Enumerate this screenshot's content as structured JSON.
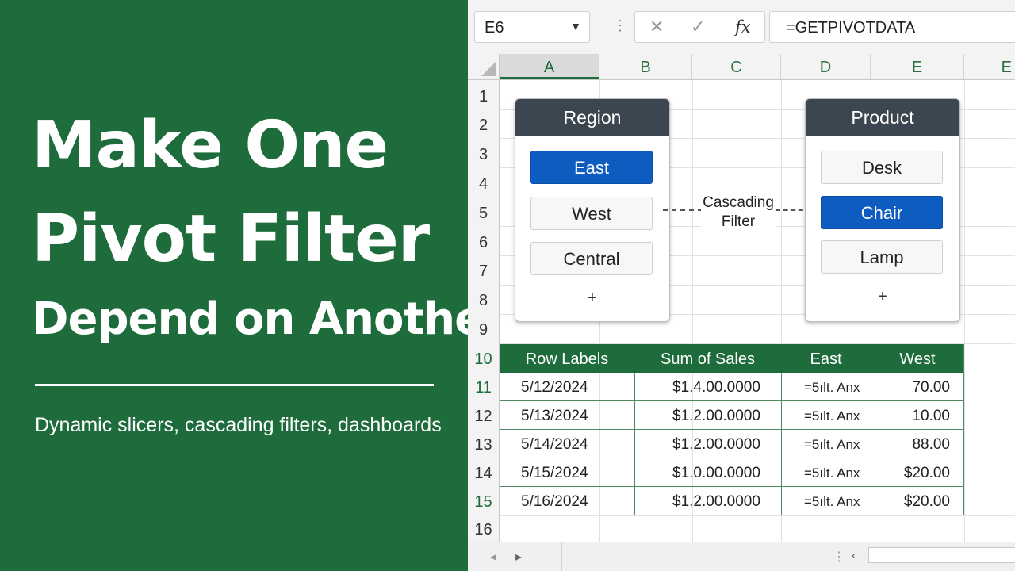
{
  "hero": {
    "line1": "Make One",
    "line2": "Pivot Filter",
    "line3": "Depend on Another",
    "subtitle": "Dynamic slicers, cascading filters, dashboards"
  },
  "formula_bar": {
    "name_box": "E6",
    "cancel_icon": "✕",
    "enter_icon": "✓",
    "fx_label": "fx",
    "formula": "=GETPIVOTDATA"
  },
  "columns": [
    "A",
    "B",
    "C",
    "D",
    "E",
    "E"
  ],
  "rows": [
    "1",
    "2",
    "3",
    "4",
    "5",
    "6",
    "7",
    "8",
    "9",
    "10",
    "11",
    "12",
    "13",
    "14",
    "15",
    "16"
  ],
  "region_slicer": {
    "title": "Region",
    "items": [
      {
        "label": "East",
        "selected": true
      },
      {
        "label": "West",
        "selected": false
      },
      {
        "label": "Central",
        "selected": false
      }
    ],
    "add": "+"
  },
  "product_slicer": {
    "title": "Product",
    "items": [
      {
        "label": "Desk",
        "selected": false
      },
      {
        "label": "Chair",
        "selected": true
      },
      {
        "label": "Lamp",
        "selected": false
      }
    ],
    "add": "+"
  },
  "connector_label": {
    "line1": "Cascading",
    "line2": "Filter"
  },
  "pivot": {
    "headers": [
      "Row Labels",
      "Sum of Sales",
      "East",
      "West"
    ],
    "rows": [
      {
        "label": "5/12/2024",
        "sum": "$1.4.00.0000",
        "east": "=5ılt. Anx",
        "west": "70.00"
      },
      {
        "label": "5/13/2024",
        "sum": "$1.2.00.0000",
        "east": "=5ılt. Anx",
        "west": "10.00"
      },
      {
        "label": "5/14/2024",
        "sum": "$1.2.00.0000",
        "east": "=5ılt. Anx",
        "west": "88.00"
      },
      {
        "label": "5/15/2024",
        "sum": "$1.0.00.0000",
        "east": "=5ılt. Anx",
        "west": "$20.00"
      },
      {
        "label": "5/16/2024",
        "sum": "$1.2.00.0000",
        "east": "=5ılt. Anx",
        "west": "$20.00"
      }
    ]
  },
  "bottom_bar": {
    "prev_icon": "◂",
    "next_icon": "▸",
    "menu_icon": "⋮",
    "scroll_left_icon": "‹"
  },
  "colors": {
    "excel_green": "#1e6b3c",
    "slicer_header": "#3c4650",
    "slicer_selected": "#0f5cc0"
  }
}
